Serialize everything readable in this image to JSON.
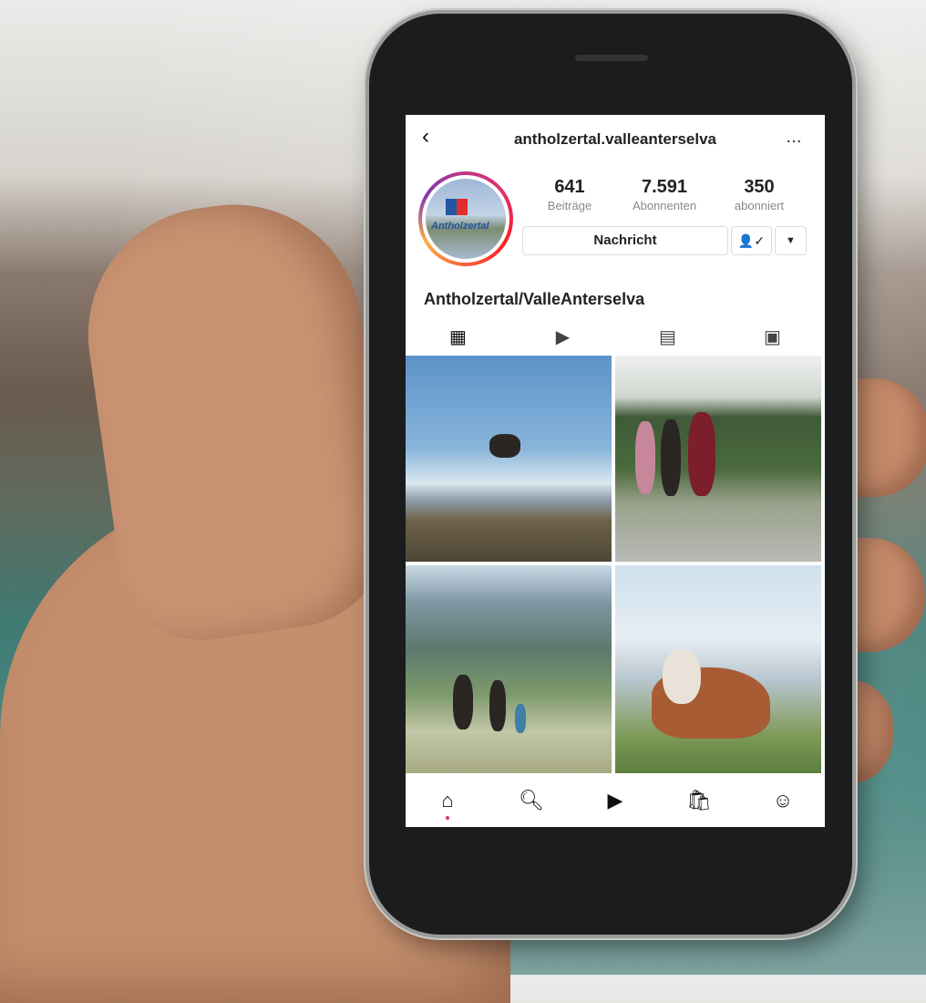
{
  "profile": {
    "username": "antholzertal.valleanterselva",
    "display_name": "Antholzertal/ValleAnterselva",
    "avatar_text": "Antholzertal",
    "stats": [
      {
        "value": "641",
        "label": "Beiträge"
      },
      {
        "value": "7.591",
        "label": "Abonnenten"
      },
      {
        "value": "350",
        "label": "abonniert"
      }
    ],
    "message_button": "Nachricht",
    "follow_icon": "person-check-icon",
    "dropdown_icon": "caret-down-icon"
  },
  "header": {
    "back_icon": "back-chevron-icon",
    "more_icon": "more-horizontal-icon"
  },
  "tabs": [
    {
      "name": "grid-tab",
      "icon": "grid-icon",
      "active": true
    },
    {
      "name": "reels-tab",
      "icon": "reels-icon",
      "active": false
    },
    {
      "name": "guides-tab",
      "icon": "guides-icon",
      "active": false
    },
    {
      "name": "tagged-tab",
      "icon": "tagged-icon",
      "active": false
    }
  ],
  "posts": [
    {
      "name": "post-jumping-hiker",
      "icon": "photo"
    },
    {
      "name": "post-cyclists",
      "icon": "photo"
    },
    {
      "name": "post-hiking-family",
      "icon": "photo"
    },
    {
      "name": "post-cow",
      "icon": "photo"
    }
  ],
  "bottom_nav": [
    {
      "name": "home",
      "icon": "home-icon",
      "active": true
    },
    {
      "name": "search",
      "icon": "search-icon",
      "active": false
    },
    {
      "name": "reels",
      "icon": "reels-icon",
      "active": false
    },
    {
      "name": "shop",
      "icon": "shop-icon",
      "active": false
    },
    {
      "name": "profile",
      "icon": "profile-icon",
      "active": false
    }
  ],
  "colors": {
    "accent": "#e1306c",
    "text": "#222222",
    "muted": "#888888",
    "border": "#dbdbdb"
  }
}
